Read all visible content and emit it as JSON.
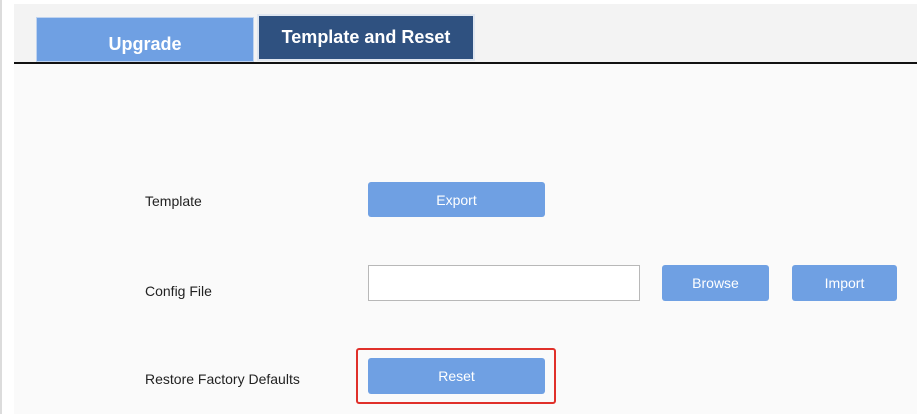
{
  "tabs": [
    {
      "label": "Upgrade",
      "active": false
    },
    {
      "label": "Template and Reset",
      "active": true
    }
  ],
  "template": {
    "label": "Template",
    "export_label": "Export"
  },
  "config_file": {
    "label": "Config File",
    "value": "",
    "placeholder": "",
    "browse_label": "Browse",
    "import_label": "Import"
  },
  "restore": {
    "label": "Restore Factory Defaults",
    "reset_label": "Reset"
  },
  "colors": {
    "button_blue": "#6fa0e3",
    "active_tab": "#2f5180",
    "highlight_red": "#e0302a"
  }
}
